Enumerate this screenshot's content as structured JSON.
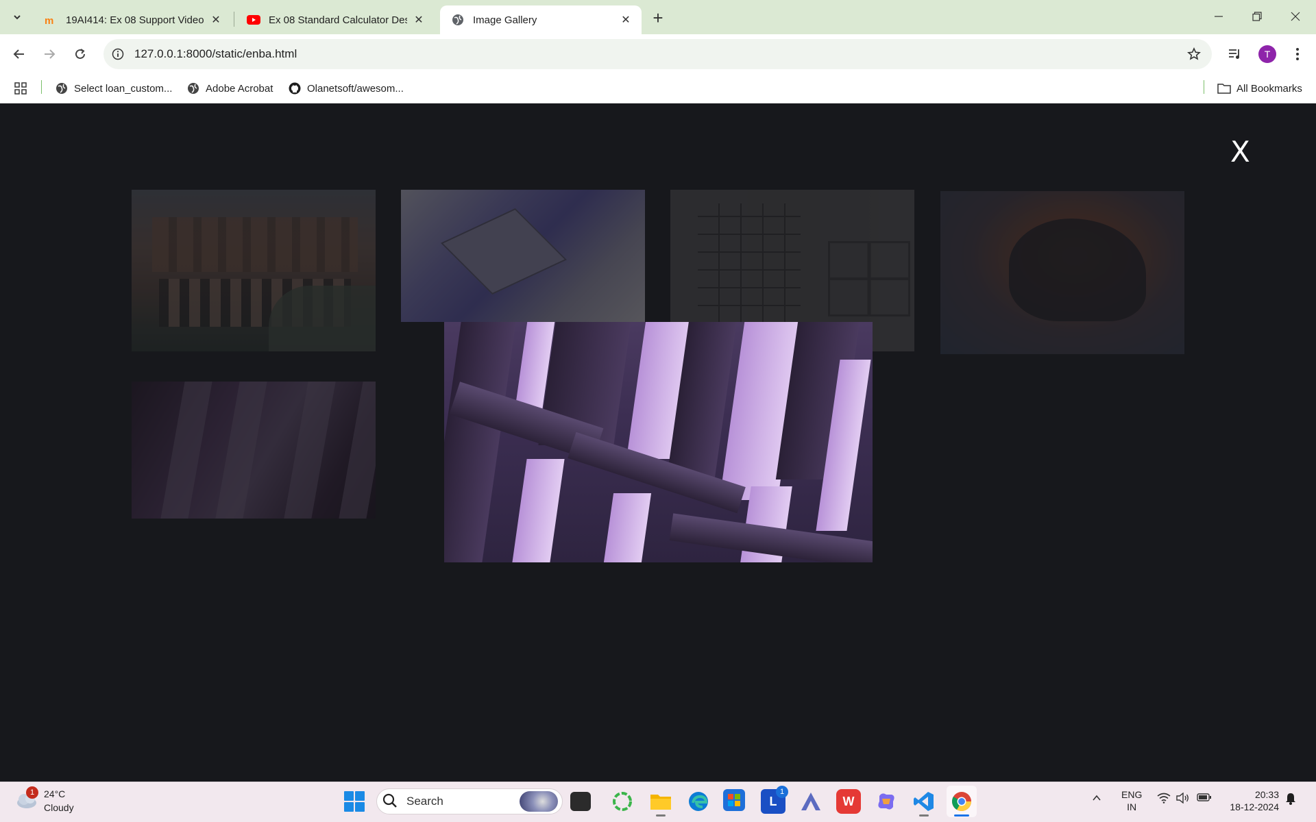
{
  "browser": {
    "tabs": [
      {
        "title": "19AI414: Ex 08 Support Video |",
        "favicon": "moodle-icon",
        "active": false
      },
      {
        "title": "Ex 08 Standard Calculator Desig",
        "favicon": "youtube-icon",
        "active": false
      },
      {
        "title": "Image Gallery",
        "favicon": "globe-icon",
        "active": true
      }
    ],
    "new_tab_label": "+",
    "url": "127.0.0.1:8000/static/enba.html",
    "profile_initial": "T",
    "bookmarks": [
      {
        "label": "Select loan_custom...",
        "icon": "globe-icon"
      },
      {
        "label": "Adobe Acrobat",
        "icon": "globe-icon"
      },
      {
        "label": "Olanetsoft/awesom...",
        "icon": "github-icon"
      }
    ],
    "all_bookmarks_label": "All Bookmarks"
  },
  "gallery": {
    "close_label": "X",
    "thumbnails": [
      {
        "subject": "gabled-houses-photo"
      },
      {
        "subject": "blue-tiles-photo"
      },
      {
        "subject": "floor-plan-photo"
      },
      {
        "subject": "hand-sunset-photo"
      },
      {
        "subject": "purple-pillars-photo"
      }
    ],
    "enlarged": {
      "subject": "purple-pillars-photo"
    }
  },
  "taskbar": {
    "weather": {
      "temp": "24°C",
      "desc": "Cloudy",
      "badge": "1"
    },
    "search_placeholder": "Search",
    "apps": [
      {
        "name": "file-explorer-dark"
      },
      {
        "name": "circle-app"
      },
      {
        "name": "file-explorer"
      },
      {
        "name": "edge"
      },
      {
        "name": "microsoft-store"
      },
      {
        "name": "l-app",
        "label": "L",
        "badge": "1"
      },
      {
        "name": "a-app"
      },
      {
        "name": "wps-office",
        "label": "W"
      },
      {
        "name": "copilot"
      },
      {
        "name": "vscode"
      },
      {
        "name": "chrome"
      }
    ],
    "lang_top": "ENG",
    "lang_bottom": "IN",
    "time": "20:33",
    "date": "18-12-2024"
  },
  "colors": {
    "page_bg": "#17181c",
    "tabbar_bg": "#dbe9d3",
    "accent_purple": "#8e24aa",
    "start_blue": "#1a8ae5"
  }
}
